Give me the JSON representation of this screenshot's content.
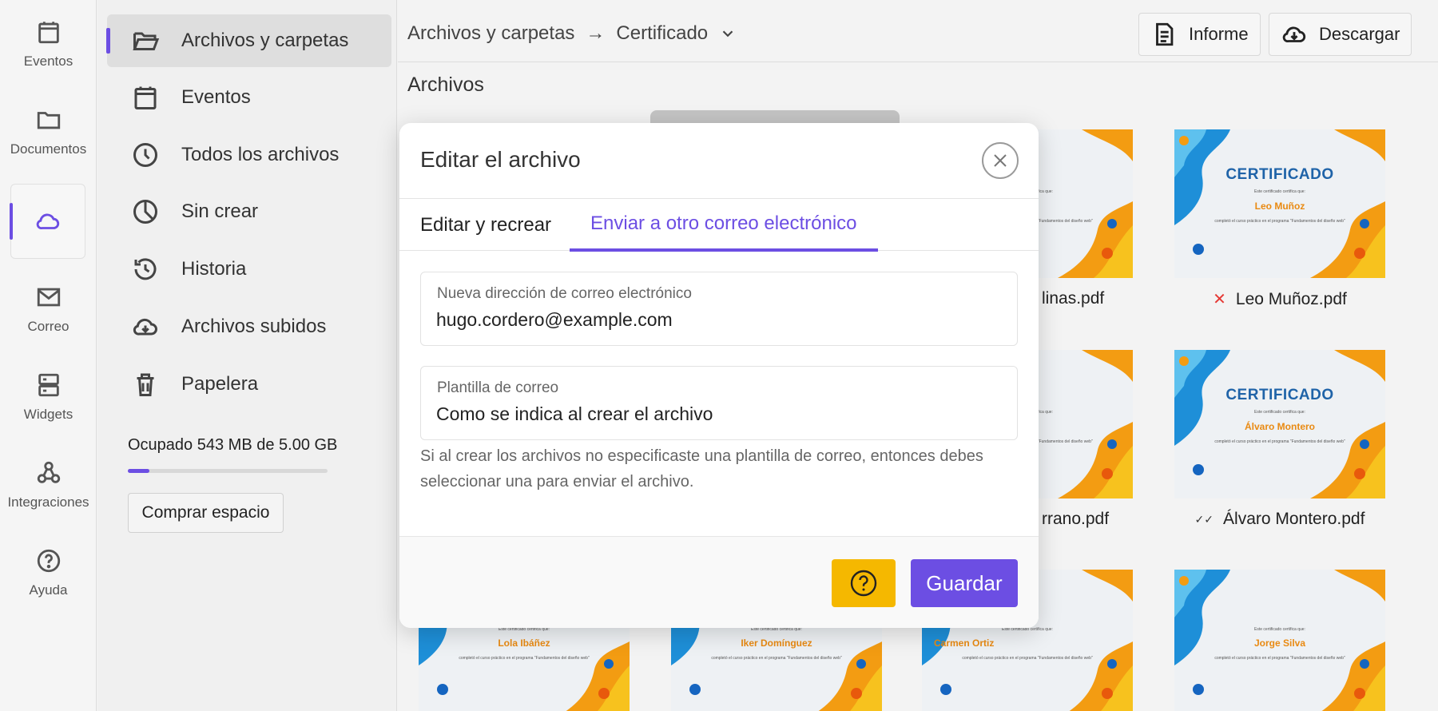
{
  "rail": {
    "items": [
      {
        "label": "Eventos",
        "icon": "calendar-icon"
      },
      {
        "label": "Documentos",
        "icon": "folder-icon"
      },
      {
        "label": "",
        "icon": "cloud-icon"
      },
      {
        "label": "Correo",
        "icon": "mail-icon"
      },
      {
        "label": "Widgets",
        "icon": "widgets-icon"
      },
      {
        "label": "Integraciones",
        "icon": "integrations-icon"
      },
      {
        "label": "Ayuda",
        "icon": "help-icon"
      }
    ]
  },
  "sidebar": {
    "items": [
      {
        "label": "Archivos y carpetas",
        "icon": "folder-open-icon"
      },
      {
        "label": "Eventos",
        "icon": "calendar-icon"
      },
      {
        "label": "Todos los archivos",
        "icon": "clock-icon"
      },
      {
        "label": "Sin crear",
        "icon": "pie-chart-icon"
      },
      {
        "label": "Historia",
        "icon": "history-icon"
      },
      {
        "label": "Archivos subidos",
        "icon": "cloud-upload-icon"
      },
      {
        "label": "Papelera",
        "icon": "trash-icon"
      }
    ],
    "storage_text": "Ocupado 543 MB de 5.00 GB",
    "storage_fraction": 0.106,
    "buy_label": "Comprar espacio"
  },
  "header": {
    "breadcrumb_root": "Archivos y carpetas",
    "breadcrumb_arrow": "→",
    "breadcrumb_current": "Certificado",
    "report_label": "Informe",
    "download_label": "Descargar"
  },
  "main": {
    "section_title": "Archivos",
    "certificate_heading_full": "CERTIFICADO",
    "certificate_heading_partial": "CADO",
    "certificate_subtitle": "Este certificado certifica que:",
    "certificate_course": "completó el curso práctico en el programa \"Fundamentos del diseño web\"",
    "files": [
      {
        "filename": "linas.pdf",
        "recipient": "linas",
        "status": ""
      },
      {
        "filename": "Leo Muñoz.pdf",
        "recipient": "Leo Muñoz",
        "status": "✕"
      },
      {
        "filename": "rrano.pdf",
        "recipient": "rrano",
        "status": ""
      },
      {
        "filename": "Álvaro Montero.pdf",
        "recipient": "Álvaro Montero",
        "status": "✓✓"
      },
      {
        "filename": "",
        "recipient": "Lola Ibáñez",
        "status": ""
      },
      {
        "filename": "",
        "recipient": "Iker Domínguez",
        "status": ""
      },
      {
        "filename": "",
        "recipient": "Carmen Ortiz",
        "status": ""
      },
      {
        "filename": "",
        "recipient": "Jorge Silva",
        "status": ""
      }
    ]
  },
  "modal": {
    "title": "Editar el archivo",
    "tabs": [
      "Editar y recrear",
      "Enviar a otro correo electrónico"
    ],
    "email_label": "Nueva dirección de correo electrónico",
    "email_value": "hugo.cordero@example.com",
    "template_label": "Plantilla de correo",
    "template_value": "Como se indica al crear el archivo",
    "hint": "Si al crear los archivos no especificaste una plantilla de correo, entonces debes seleccionar una para enviar el archivo.",
    "save_label": "Guardar"
  },
  "colors": {
    "accent": "#6c4ee3",
    "help_button": "#f5b800",
    "error": "#e53935",
    "certificate_blue": "#1f63a8",
    "certificate_orange": "#f39c12"
  }
}
